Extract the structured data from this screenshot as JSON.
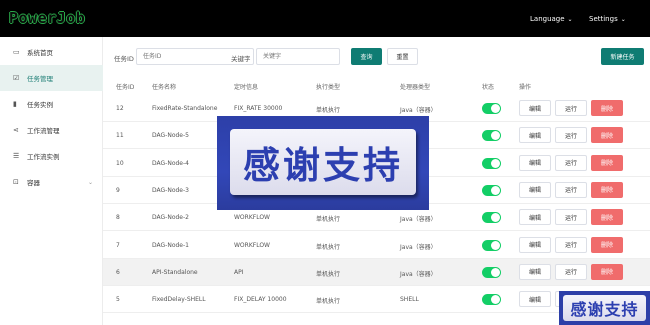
{
  "app": {
    "logo": "PowerJob"
  },
  "topnav": {
    "language": "Language",
    "settings": "Settings",
    "caret": "⌄"
  },
  "sidebar": {
    "items": [
      {
        "label": "系统首页",
        "icon": "monitor-icon",
        "glyph": "▭"
      },
      {
        "label": "任务管理",
        "icon": "task-icon",
        "glyph": "☑"
      },
      {
        "label": "任务实例",
        "icon": "bar-chart-icon",
        "glyph": "▮"
      },
      {
        "label": "工作流管理",
        "icon": "share-icon",
        "glyph": "⋖"
      },
      {
        "label": "工作流实例",
        "icon": "list-icon",
        "glyph": "☰"
      },
      {
        "label": "容器",
        "icon": "container-icon",
        "glyph": "⊡"
      }
    ],
    "active_index": 1
  },
  "filters": {
    "job_id_label": "任务ID",
    "job_id_placeholder": "任务ID",
    "keyword_label": "关键字",
    "keyword_placeholder": "关键字",
    "query_button": "查询",
    "reset_button": "重置",
    "new_button": "新建任务"
  },
  "table": {
    "headers": [
      "任务ID",
      "任务名称",
      "定时信息",
      "执行类型",
      "处理器类型",
      "状态",
      "操作"
    ],
    "actions": {
      "edit": "编辑",
      "run": "运行",
      "delete": "删除"
    },
    "rows": [
      {
        "id": "12",
        "name": "FixedRate-Standalone",
        "timing": "FIX_RATE 30000",
        "exec": "单机执行",
        "processor": "Java（容器）",
        "enabled": true
      },
      {
        "id": "11",
        "name": "DAG-Node-5",
        "timing": "",
        "exec": "",
        "processor": "",
        "enabled": true
      },
      {
        "id": "10",
        "name": "DAG-Node-4",
        "timing": "",
        "exec": "",
        "processor": "",
        "enabled": true
      },
      {
        "id": "9",
        "name": "DAG-Node-3",
        "timing": "",
        "exec": "",
        "processor": "",
        "enabled": true
      },
      {
        "id": "8",
        "name": "DAG-Node-2",
        "timing": "WORKFLOW",
        "exec": "单机执行",
        "processor": "Java（容器）",
        "enabled": true
      },
      {
        "id": "7",
        "name": "DAG-Node-1",
        "timing": "WORKFLOW",
        "exec": "单机执行",
        "processor": "Java（容器）",
        "enabled": true
      },
      {
        "id": "6",
        "name": "API-Standalone",
        "timing": "API",
        "exec": "单机执行",
        "processor": "Java（容器）",
        "enabled": true
      },
      {
        "id": "5",
        "name": "FixedDelay-SHELL",
        "timing": "FIX_DELAY 10000",
        "exec": "单机执行",
        "processor": "SHELL",
        "enabled": true
      }
    ],
    "highlighted_row": 6
  },
  "overlays": {
    "big_text": "感谢支持",
    "small_text": "感谢支持"
  },
  "colors": {
    "primary": "#0f7c73",
    "danger": "#f06c6c",
    "switch_on": "#13ce66",
    "overlay_blue": "#2d3fa8"
  }
}
